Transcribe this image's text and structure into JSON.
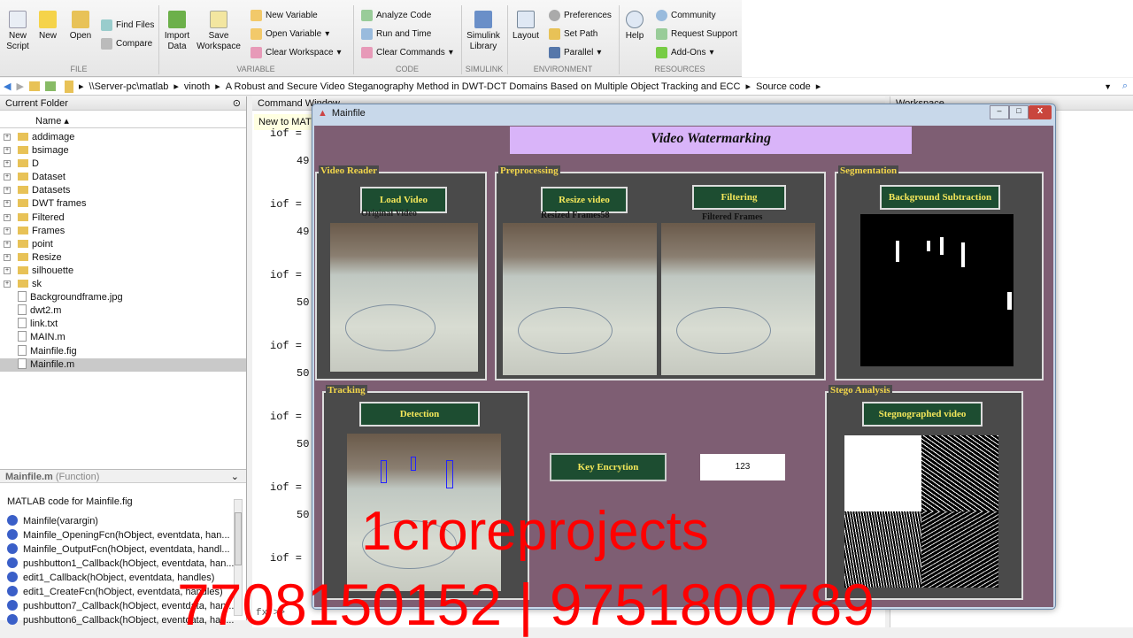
{
  "ribbon": {
    "file": {
      "new_script": "New Script",
      "new": "New",
      "open": "Open",
      "find_files": "Find Files",
      "compare": "Compare",
      "group": "FILE"
    },
    "variable": {
      "import": "Import Data",
      "save_ws": "Save Workspace",
      "new_var": "New Variable",
      "open_var": "Open Variable",
      "clear_ws": "Clear Workspace",
      "group": "VARIABLE"
    },
    "code": {
      "analyze": "Analyze Code",
      "run_time": "Run and Time",
      "clear_cmd": "Clear Commands",
      "group": "CODE"
    },
    "simulink": {
      "library": "Simulink Library",
      "group": "SIMULINK"
    },
    "environment": {
      "layout": "Layout",
      "preferences": "Preferences",
      "set_path": "Set Path",
      "parallel": "Parallel",
      "group": "ENVIRONMENT"
    },
    "resources": {
      "help": "Help",
      "community": "Community",
      "request_support": "Request Support",
      "addons": "Add-Ons",
      "group": "RESOURCES"
    }
  },
  "address": {
    "parts": [
      "\\\\Server-pc\\matlab",
      "vinoth",
      "A Robust and Secure Video Steganography Method in DWT-DCT Domains Based on Multiple Object Tracking and ECC",
      "Source code"
    ]
  },
  "current_folder": {
    "title": "Current Folder",
    "name_col": "Name",
    "items": [
      {
        "name": "addimage",
        "type": "folder"
      },
      {
        "name": "bsimage",
        "type": "folder"
      },
      {
        "name": "D",
        "type": "folder"
      },
      {
        "name": "Dataset",
        "type": "folder"
      },
      {
        "name": "Datasets",
        "type": "folder"
      },
      {
        "name": "DWT frames",
        "type": "folder"
      },
      {
        "name": "Filtered",
        "type": "folder"
      },
      {
        "name": "Frames",
        "type": "folder"
      },
      {
        "name": "point",
        "type": "folder"
      },
      {
        "name": "Resize",
        "type": "folder"
      },
      {
        "name": "silhouette",
        "type": "folder"
      },
      {
        "name": "sk",
        "type": "folder"
      },
      {
        "name": "Backgroundframe.jpg",
        "type": "file"
      },
      {
        "name": "dwt2.m",
        "type": "file"
      },
      {
        "name": "link.txt",
        "type": "file"
      },
      {
        "name": "MAIN.m",
        "type": "file"
      },
      {
        "name": "Mainfile.fig",
        "type": "file"
      },
      {
        "name": "Mainfile.m",
        "type": "file"
      }
    ]
  },
  "details": {
    "title": "Mainfile.m",
    "subtitle": "(Function)",
    "desc": "MATLAB code for Mainfile.fig",
    "functions": [
      "Mainfile(varargin)",
      "Mainfile_OpeningFcn(hObject, eventdata, han...",
      "Mainfile_OutputFcn(hObject, eventdata, handl...",
      "pushbutton1_Callback(hObject, eventdata, han...",
      "edit1_Callback(hObject, eventdata, handles)",
      "edit1_CreateFcn(hObject, eventdata, handles)",
      "pushbutton7_Callback(hObject, eventdata, han...",
      "pushbutton6_Callback(hObject, eventdata, han..."
    ]
  },
  "command_window": {
    "title": "Command Window",
    "banner": "New to MATLAB?",
    "lines": [
      "iof =",
      "49",
      "iof =",
      "49",
      "iof =",
      "50",
      "iof =",
      "50",
      "iof =",
      "50",
      "iof =",
      "50",
      "iof ="
    ],
    "prompt": "fx >>"
  },
  "workspace": {
    "title": "Workspace"
  },
  "figure": {
    "title": "Mainfile",
    "heading": "Video Watermarking",
    "panels": {
      "reader": "Video Reader",
      "preprocessing": "Preprocessing",
      "segmentation": "Segmentation",
      "tracking": "Tracking",
      "stego": "Stego Analysis"
    },
    "buttons": {
      "load_video": "Load Video",
      "resize_video": "Resize video",
      "filtering": "Filtering",
      "bg_sub": "Background Subtraction",
      "detection": "Detection",
      "key_enc": "Key Encrytion",
      "stego_video": "Stegnographed video"
    },
    "labels": {
      "original": "Original Video",
      "resized": "Resized Frames58",
      "filtered": "Filtered Frames"
    },
    "key_value": "123"
  },
  "watermark": {
    "brand": "1croreprojects",
    "phones": "7708150152 | 9751800789"
  }
}
